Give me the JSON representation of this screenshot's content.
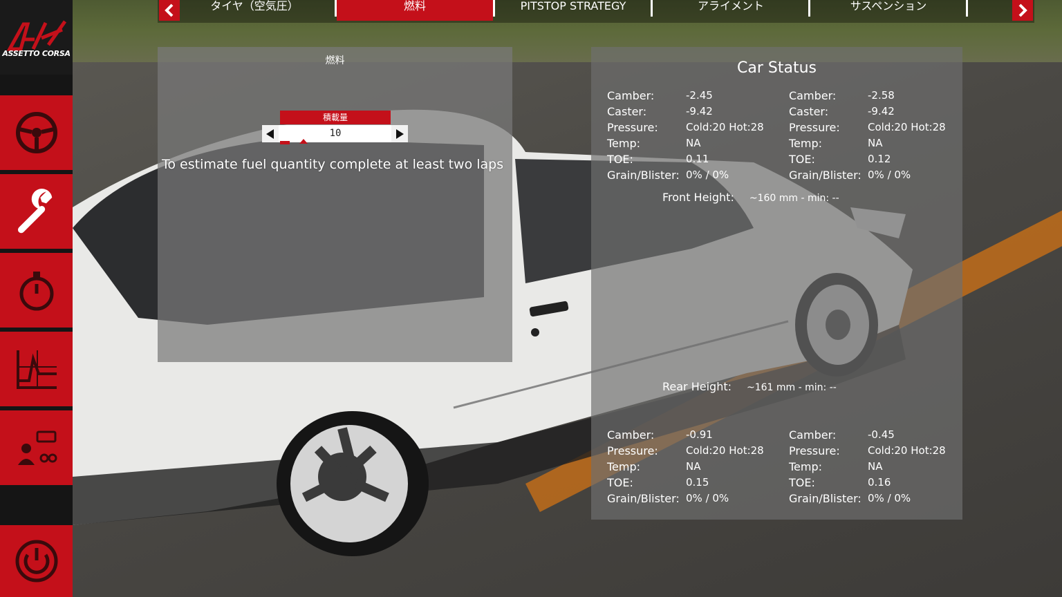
{
  "sidebar": {
    "logo_text": "ASSETTO CORSA",
    "items": [
      {
        "id": "steering",
        "icon": "steering-wheel-icon"
      },
      {
        "id": "setup",
        "icon": "wrench-icon"
      },
      {
        "id": "timing",
        "icon": "stopwatch-icon"
      },
      {
        "id": "telemetry",
        "icon": "chart-icon"
      },
      {
        "id": "pitstop",
        "icon": "pit-crew-icon"
      },
      {
        "id": "power",
        "icon": "power-icon"
      }
    ],
    "accent_color": "#c4101a"
  },
  "tabs": {
    "items": [
      {
        "label": "タイヤ（空気圧）"
      },
      {
        "label": "燃料",
        "active": true
      },
      {
        "label": "PITSTOP STRATEGY"
      },
      {
        "label": "アライメント"
      },
      {
        "label": "サスペンション"
      }
    ],
    "prev_icon": "chevron-left-icon",
    "next_icon": "chevron-right-icon"
  },
  "fuel": {
    "title": "燃料",
    "stepper_label": "積載量",
    "value": "10",
    "message": "To estimate fuel quantity complete at least two laps"
  },
  "car_status": {
    "title": "Car Status",
    "front_left": [
      {
        "k": "Camber:",
        "v": "-2.45"
      },
      {
        "k": "Caster:",
        "v": "-9.42"
      },
      {
        "k": "Pressure:",
        "v": "Cold:20 Hot:28"
      },
      {
        "k": "Temp:",
        "v": "NA"
      },
      {
        "k": "TOE:",
        "v": "0.11"
      },
      {
        "k": "Grain/Blister:",
        "v": "0% / 0%"
      }
    ],
    "front_right": [
      {
        "k": "Camber:",
        "v": "-2.58"
      },
      {
        "k": "Caster:",
        "v": "-9.42"
      },
      {
        "k": "Pressure:",
        "v": "Cold:20 Hot:28"
      },
      {
        "k": "Temp:",
        "v": "NA"
      },
      {
        "k": "TOE:",
        "v": "0.12"
      },
      {
        "k": "Grain/Blister:",
        "v": "0% / 0%"
      }
    ],
    "front_height_label": "Front Height:",
    "front_height_value": "~160 mm - min: --",
    "rear_height_label": "Rear Height:",
    "rear_height_value": "~161 mm - min: --",
    "rear_left": [
      {
        "k": "Camber:",
        "v": "-0.91"
      },
      {
        "k": "Pressure:",
        "v": "Cold:20 Hot:28"
      },
      {
        "k": "Temp:",
        "v": "NA"
      },
      {
        "k": "TOE:",
        "v": "0.15"
      },
      {
        "k": "Grain/Blister:",
        "v": "0% / 0%"
      }
    ],
    "rear_right": [
      {
        "k": "Camber:",
        "v": "-0.45"
      },
      {
        "k": "Pressure:",
        "v": "Cold:20 Hot:28"
      },
      {
        "k": "Temp:",
        "v": "NA"
      },
      {
        "k": "TOE:",
        "v": "0.16"
      },
      {
        "k": "Grain/Blister:",
        "v": "0% / 0%"
      }
    ]
  }
}
